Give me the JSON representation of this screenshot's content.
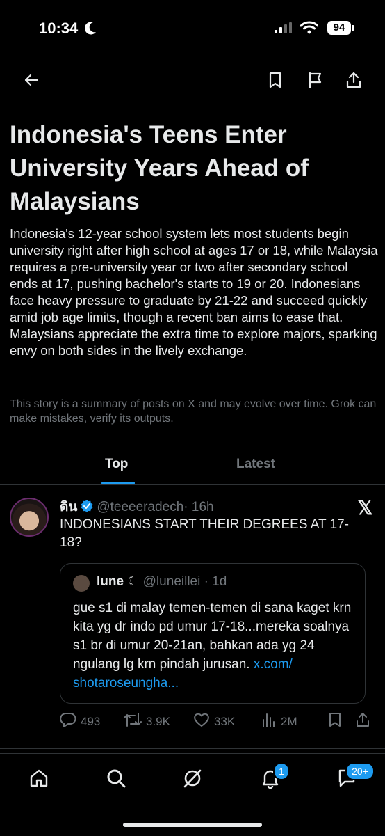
{
  "status_bar": {
    "time": "10:34",
    "battery": "94"
  },
  "article": {
    "title": "Indonesia's Teens Enter University Years Ahead of Malaysians",
    "summary": "Indonesia's 12-year school system lets most students begin university right after high school at ages 17 or 18, while Malaysia requires a pre-university year or two after secondary school ends at 17, pushing bachelor's starts to 19 or 20. Indonesians face heavy pressure to graduate by 21-22 and succeed quickly amid job age limits, though a recent ban aims to ease that. Malaysians appreciate the extra time to explore majors, sparking envy on both sides in the lively exchange.",
    "disclaimer": "This story is a summary of posts on X and may evolve over time. Grok can make mistakes, verify its outputs."
  },
  "tabs": [
    {
      "label": "Top",
      "active": true
    },
    {
      "label": "Latest",
      "active": false
    }
  ],
  "post": {
    "name": "ดิน",
    "handle": "@teeeeradech",
    "time": "· 16h",
    "text": "INDONESIANS START THEIR DEGREES AT 17-18?",
    "quote": {
      "name": "lune",
      "moon": "☾",
      "handle": "@luneillei",
      "time": "· 1d",
      "text": "gue s1 di malay temen-temen di sana kaget krn kita yg dr indo pd umur 17-18...mereka soalnya s1 br di umur 20-21an, bahkan ada yg 24 ngulang lg krn pindah jurusan. ",
      "link": "x.com/ shotaroseungha..."
    },
    "stats": {
      "replies": "493",
      "reposts": "3.9K",
      "likes": "33K",
      "views": "2M"
    }
  },
  "bottom_nav": {
    "notifications_badge": "1",
    "messages_badge": "20+"
  },
  "colors": {
    "accent": "#1d9bf0",
    "background": "#000000",
    "muted": "#71767b"
  }
}
